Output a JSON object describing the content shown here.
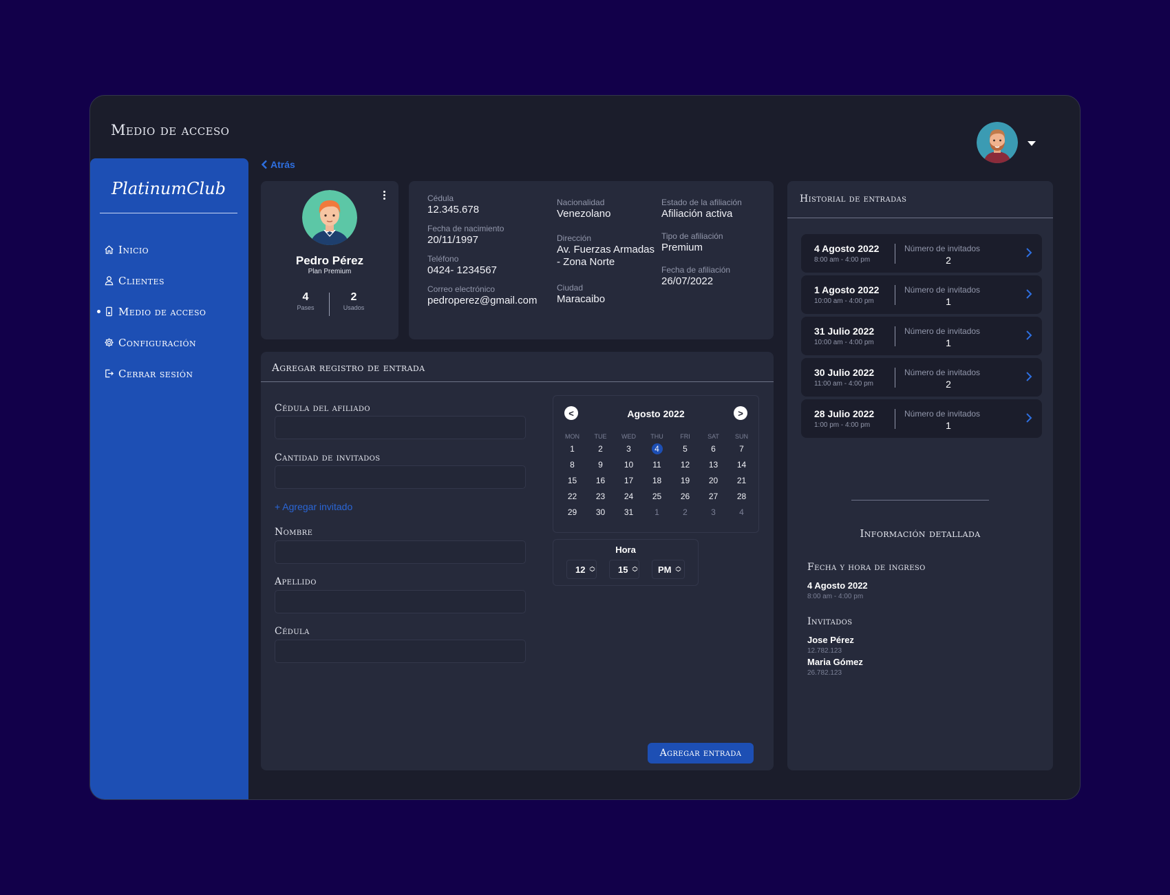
{
  "app": {
    "title": "Medio de acceso"
  },
  "sidebar": {
    "logo": "PlatinumClub",
    "items": [
      {
        "label": "Inicio",
        "icon": "home-icon"
      },
      {
        "label": "Clientes",
        "icon": "user-icon"
      },
      {
        "label": "Medio de acceso",
        "icon": "phone-icon",
        "active": true
      },
      {
        "label": "Configuración",
        "icon": "gear-icon"
      },
      {
        "label": "Cerrar sesión",
        "icon": "logout-icon"
      }
    ]
  },
  "back": {
    "label": "Atrás"
  },
  "profile": {
    "name": "Pedro Pérez",
    "plan": "Plan Premium",
    "passes": {
      "value": "4",
      "label": "Pases"
    },
    "used": {
      "value": "2",
      "label": "Usados"
    }
  },
  "info": {
    "cedula": {
      "label": "Cédula",
      "value": "12.345.678"
    },
    "nacimiento": {
      "label": "Fecha de nacimiento",
      "value": "20/11/1997"
    },
    "telefono": {
      "label": "Teléfono",
      "value": "0424- 1234567"
    },
    "correo": {
      "label": "Correo electrónico",
      "value": "pedroperez@gmail.com"
    },
    "nacionalidad": {
      "label": "Nacionalidad",
      "value": "Venezolano"
    },
    "direccion": {
      "label": "Dirección",
      "value1": "Av. Fuerzas Armadas",
      "value2": "- Zona Norte"
    },
    "ciudad": {
      "label": "Ciudad",
      "value": "Maracaibo"
    },
    "estado": {
      "label": "Estado de la afiliación",
      "value": "Afiliación activa"
    },
    "tipo": {
      "label": "Tipo de afiliación",
      "value": "Premium"
    },
    "fecha_afiliacion": {
      "label": "Fecha de afiliación",
      "value": "26/07/2022"
    }
  },
  "entry_form": {
    "title": "Agregar registro de entrada",
    "cedula_afiliado": {
      "label": "Cédula del afiliado",
      "value": ""
    },
    "cantidad_invitados": {
      "label": "Cantidad de invitados",
      "value": ""
    },
    "add_guest": "+ Agregar invitado",
    "nombre": {
      "label": "Nombre",
      "value": ""
    },
    "apellido": {
      "label": "Apellido",
      "value": ""
    },
    "cedula": {
      "label": "Cédula",
      "value": ""
    },
    "submit": "Agregar entrada"
  },
  "calendar": {
    "month": "Agosto 2022",
    "prev": "<",
    "next": ">",
    "weekdays": [
      "MON",
      "TUE",
      "WED",
      "THU",
      "FRI",
      "SAT",
      "SUN"
    ],
    "weeks": [
      [
        "1",
        "2",
        "3",
        "4",
        "5",
        "6",
        "7"
      ],
      [
        "8",
        "9",
        "10",
        "11",
        "12",
        "13",
        "14"
      ],
      [
        "15",
        "16",
        "17",
        "18",
        "19",
        "20",
        "21"
      ],
      [
        "22",
        "23",
        "24",
        "25",
        "26",
        "27",
        "28"
      ],
      [
        "29",
        "30",
        "31",
        "1",
        "2",
        "3",
        "4"
      ]
    ],
    "selected": "4",
    "trailing_muted_count": 4
  },
  "time": {
    "title": "Hora",
    "hour": "12",
    "minute": "15",
    "period": "PM"
  },
  "history": {
    "title": "Historial de entradas",
    "guests_label": "Número de invitados",
    "items": [
      {
        "date": "4 Agosto 2022",
        "time": "8:00 am - 4:00 pm",
        "guests": "2"
      },
      {
        "date": "1 Agosto 2022",
        "time": "10:00 am - 4:00 pm",
        "guests": "1"
      },
      {
        "date": "31 Julio 2022",
        "time": "10:00 am - 4:00 pm",
        "guests": "1"
      },
      {
        "date": "30 Julio 2022",
        "time": "11:00 am - 4:00 pm",
        "guests": "2"
      },
      {
        "date": "28 Julio 2022",
        "time": "1:00 pm - 4:00 pm",
        "guests": "1"
      }
    ]
  },
  "detail": {
    "title": "Información detallada",
    "fecha_label": "Fecha y hora de ingreso",
    "fecha": "4 Agosto 2022",
    "horario": "8:00 am - 4:00 pm",
    "invitados_label": "Invitados",
    "guests": [
      {
        "name": "Jose Pérez",
        "id": "12.782.123"
      },
      {
        "name": "Maria Gómez",
        "id": "26.782.123"
      }
    ]
  },
  "colors": {
    "background": "#12004a",
    "sidebar": "#1d4fb4",
    "card": "#262a3b",
    "accent": "#2e6fe0"
  }
}
